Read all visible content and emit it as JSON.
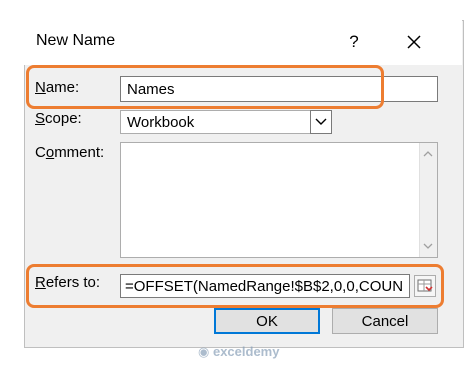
{
  "dialog": {
    "title": "New Name",
    "help_label": "?"
  },
  "fields": {
    "name_label_underlined": "N",
    "name_label_rest": "ame:",
    "name_value": "Names",
    "scope_label_underlined": "S",
    "scope_label_rest": "cope:",
    "scope_value": "Workbook",
    "comment_label_prefix": "C",
    "comment_label_underlined": "o",
    "comment_label_rest": "mment:",
    "refers_label_underlined": "R",
    "refers_label_rest": "efers to:",
    "refers_value": "=OFFSET(NamedRange!$B$2,0,0,COUN"
  },
  "buttons": {
    "ok_label": "OK",
    "cancel_label": "Cancel"
  },
  "watermark": {
    "text": "exceldemy"
  },
  "colors": {
    "highlight": "#ed7d31",
    "default_button_border": "#0078d7"
  },
  "icons": {
    "close": "close-icon",
    "dropdown": "chevron-down-icon",
    "scroll_up": "chevron-up-icon",
    "scroll_down": "chevron-down-icon",
    "collapse": "range-selector-icon"
  }
}
